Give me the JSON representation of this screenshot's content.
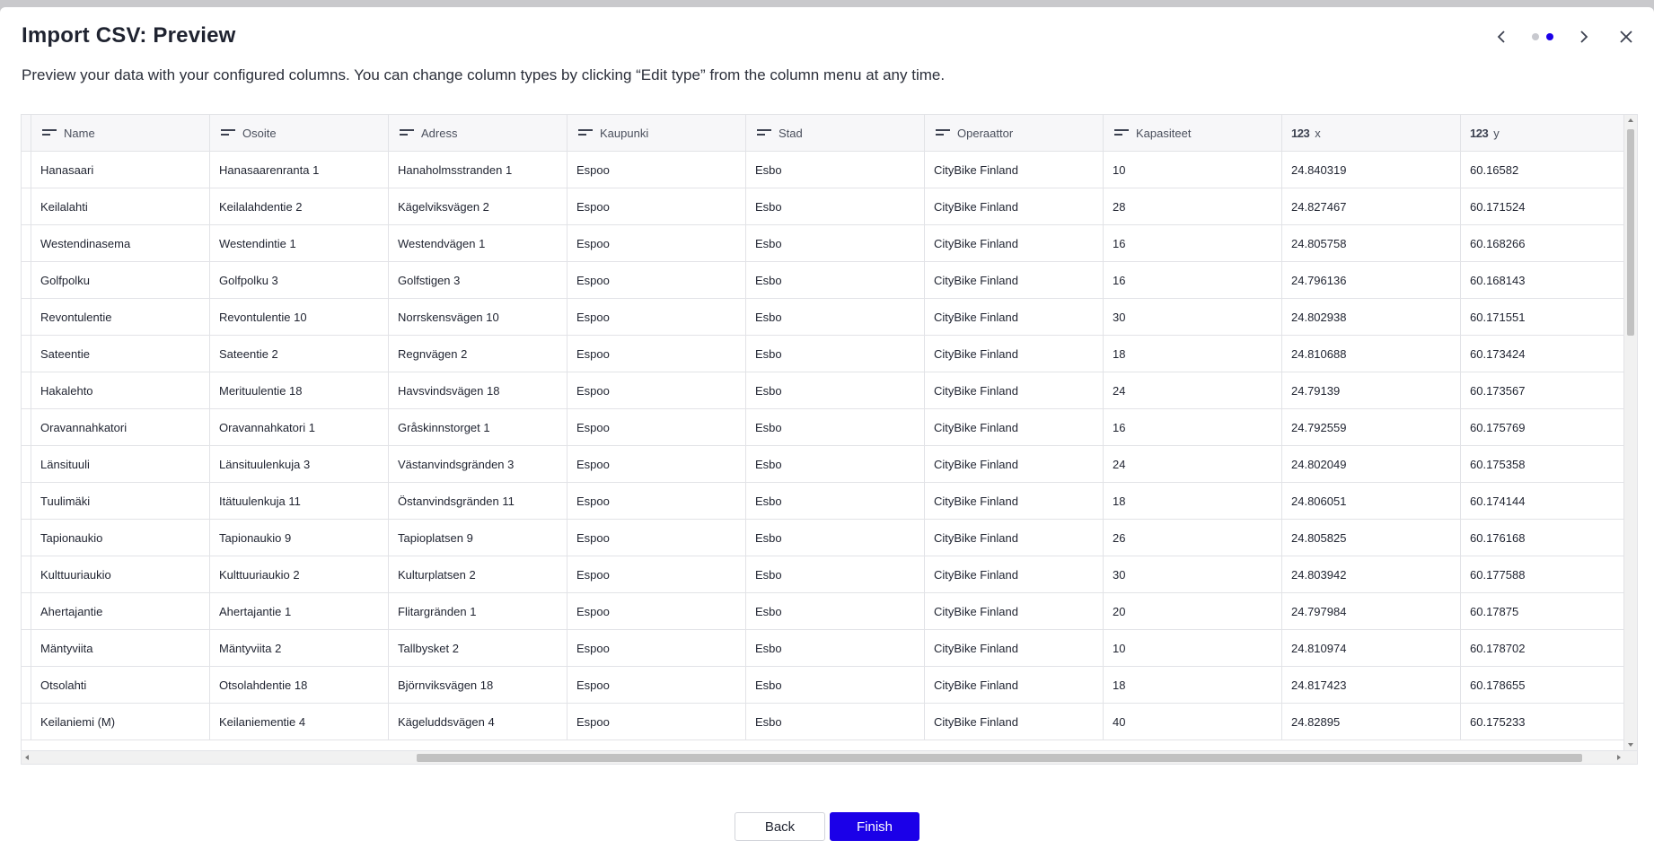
{
  "dialog": {
    "title": "Import CSV: Preview",
    "description": "Preview your data with your configured columns. You can change column types by clicking “Edit type” from the column menu at any time.",
    "step_indicator": {
      "total": 2,
      "current": 2
    },
    "colors": {
      "accent": "#1b00e8",
      "dot_inactive": "#c8c9cf"
    }
  },
  "table": {
    "columns": [
      {
        "label": "Name",
        "type_icon": "text-type-icon",
        "type_text": ""
      },
      {
        "label": "Osoite",
        "type_icon": "text-type-icon",
        "type_text": ""
      },
      {
        "label": "Adress",
        "type_icon": "text-type-icon",
        "type_text": ""
      },
      {
        "label": "Kaupunki",
        "type_icon": "text-type-icon",
        "type_text": ""
      },
      {
        "label": "Stad",
        "type_icon": "text-type-icon",
        "type_text": ""
      },
      {
        "label": "Operaattor",
        "type_icon": "text-type-icon",
        "type_text": ""
      },
      {
        "label": "Kapasiteet",
        "type_icon": "text-type-icon",
        "type_text": ""
      },
      {
        "label": "x",
        "type_icon": "number-type-icon",
        "type_text": "123"
      },
      {
        "label": "y",
        "type_icon": "number-type-icon",
        "type_text": "123"
      }
    ],
    "rows": [
      [
        "Hanasaari",
        "Hanasaarenranta 1",
        "Hanaholmsstranden 1",
        "Espoo",
        "Esbo",
        "CityBike Finland",
        "10",
        "24.840319",
        "60.16582"
      ],
      [
        "Keilalahti",
        "Keilalahdentie 2",
        "Kägelviksvägen 2",
        "Espoo",
        "Esbo",
        "CityBike Finland",
        "28",
        "24.827467",
        "60.171524"
      ],
      [
        "Westendinasema",
        "Westendintie 1",
        "Westendvägen 1",
        "Espoo",
        "Esbo",
        "CityBike Finland",
        "16",
        "24.805758",
        "60.168266"
      ],
      [
        "Golfpolku",
        "Golfpolku 3",
        "Golfstigen 3",
        "Espoo",
        "Esbo",
        "CityBike Finland",
        "16",
        "24.796136",
        "60.168143"
      ],
      [
        "Revontulentie",
        "Revontulentie 10",
        "Norrskensvägen 10",
        "Espoo",
        "Esbo",
        "CityBike Finland",
        "30",
        "24.802938",
        "60.171551"
      ],
      [
        "Sateentie",
        "Sateentie 2",
        "Regnvägen 2",
        "Espoo",
        "Esbo",
        "CityBike Finland",
        "18",
        "24.810688",
        "60.173424"
      ],
      [
        "Hakalehto",
        "Merituulentie 18",
        "Havsvindsvägen 18",
        "Espoo",
        "Esbo",
        "CityBike Finland",
        "24",
        "24.79139",
        "60.173567"
      ],
      [
        "Oravannahkatori",
        "Oravannahkatori 1",
        "Gråskinnstorget 1",
        "Espoo",
        "Esbo",
        "CityBike Finland",
        "16",
        "24.792559",
        "60.175769"
      ],
      [
        "Länsituuli",
        "Länsituulenkuja 3",
        "Västanvindsgränden 3",
        "Espoo",
        "Esbo",
        "CityBike Finland",
        "24",
        "24.802049",
        "60.175358"
      ],
      [
        "Tuulimäki",
        "Itätuulenkuja 11",
        "Östanvindsgränden 11",
        "Espoo",
        "Esbo",
        "CityBike Finland",
        "18",
        "24.806051",
        "60.174144"
      ],
      [
        "Tapionaukio",
        "Tapionaukio 9",
        "Tapioplatsen 9",
        "Espoo",
        "Esbo",
        "CityBike Finland",
        "26",
        "24.805825",
        "60.176168"
      ],
      [
        "Kulttuuriaukio",
        "Kulttuuriaukio 2",
        "Kulturplatsen 2",
        "Espoo",
        "Esbo",
        "CityBike Finland",
        "30",
        "24.803942",
        "60.177588"
      ],
      [
        "Ahertajantie",
        "Ahertajantie 1",
        "Flitargränden 1",
        "Espoo",
        "Esbo",
        "CityBike Finland",
        "20",
        "24.797984",
        "60.17875"
      ],
      [
        "Mäntyviita",
        "Mäntyviita 2",
        "Tallbysket 2",
        "Espoo",
        "Esbo",
        "CityBike Finland",
        "10",
        "24.810974",
        "60.178702"
      ],
      [
        "Otsolahti",
        "Otsolahdentie 18",
        "Björnviksvägen 18",
        "Espoo",
        "Esbo",
        "CityBike Finland",
        "18",
        "24.817423",
        "60.178655"
      ],
      [
        "Keilaniemi (M)",
        "Keilaniementie 4",
        "Kägeluddsvägen 4",
        "Espoo",
        "Esbo",
        "CityBike Finland",
        "40",
        "24.82895",
        "60.175233"
      ]
    ]
  },
  "footer": {
    "back_label": "Back",
    "finish_label": "Finish"
  }
}
